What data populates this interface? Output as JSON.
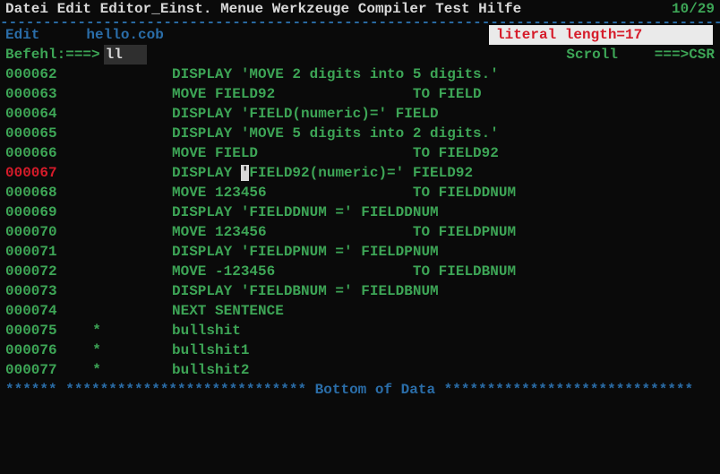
{
  "menubar": {
    "items": [
      "Datei",
      "Edit",
      "Editor_Einst.",
      "Menue",
      "Werkzeuge",
      "Compiler",
      "Test",
      "Hilfe"
    ],
    "counter": "10/29"
  },
  "title": {
    "mode": "Edit",
    "file": "hello.cob"
  },
  "status": "literal length=17",
  "command": {
    "label": "Befehl:",
    "arrow": " ===>",
    "value": "ll"
  },
  "scroll": {
    "label": "Scroll",
    "arrow": "===>",
    "value": "CSR"
  },
  "lines": [
    {
      "seq": "000062",
      "highlight": false,
      "ind": "",
      "text": "DISPLAY 'MOVE 2 digits into 5 digits.'"
    },
    {
      "seq": "000063",
      "highlight": false,
      "ind": "",
      "text": "MOVE FIELD92                TO FIELD"
    },
    {
      "seq": "000064",
      "highlight": false,
      "ind": "",
      "text": "DISPLAY 'FIELD(numeric)=' FIELD"
    },
    {
      "seq": "000065",
      "highlight": false,
      "ind": "",
      "text": "DISPLAY 'MOVE 5 digits into 2 digits.'"
    },
    {
      "seq": "000066",
      "highlight": false,
      "ind": "",
      "text": "MOVE FIELD                  TO FIELD92"
    },
    {
      "seq": "000067",
      "highlight": true,
      "ind": "",
      "text": "DISPLAY 'FIELD92(numeric)=' FIELD92",
      "cursor_at": 8
    },
    {
      "seq": "000068",
      "highlight": false,
      "ind": "",
      "text": "MOVE 123456                 TO FIELDDNUM"
    },
    {
      "seq": "000069",
      "highlight": false,
      "ind": "",
      "text": "DISPLAY 'FIELDDNUM =' FIELDDNUM"
    },
    {
      "seq": "000070",
      "highlight": false,
      "ind": "",
      "text": "MOVE 123456                 TO FIELDPNUM"
    },
    {
      "seq": "000071",
      "highlight": false,
      "ind": "",
      "text": "DISPLAY 'FIELDPNUM =' FIELDPNUM"
    },
    {
      "seq": "000072",
      "highlight": false,
      "ind": "",
      "text": "MOVE -123456                TO FIELDBNUM"
    },
    {
      "seq": "000073",
      "highlight": false,
      "ind": "",
      "text": "DISPLAY 'FIELDBNUM =' FIELDBNUM"
    },
    {
      "seq": "000074",
      "highlight": false,
      "ind": "",
      "text": "NEXT SENTENCE"
    },
    {
      "seq": "000075",
      "highlight": false,
      "ind": "*",
      "text": "bullshit"
    },
    {
      "seq": "000076",
      "highlight": false,
      "ind": "*",
      "text": "bullshit1"
    },
    {
      "seq": "000077",
      "highlight": false,
      "ind": "*",
      "text": "bullshit2"
    }
  ],
  "bottom": "****** **************************** Bottom of Data *****************************"
}
